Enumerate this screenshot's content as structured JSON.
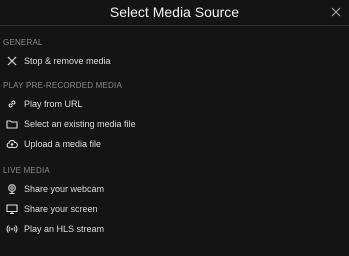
{
  "dialog": {
    "title": "Select Media Source"
  },
  "sections": {
    "general": {
      "heading": "GENERAL",
      "items": [
        {
          "label": "Stop & remove media",
          "icon": "close-icon"
        }
      ]
    },
    "recorded": {
      "heading": "PLAY PRE-RECORDED MEDIA",
      "items": [
        {
          "label": "Play from URL",
          "icon": "link-icon"
        },
        {
          "label": "Select an existing media file",
          "icon": "folder-icon"
        },
        {
          "label": "Upload a media file",
          "icon": "cloud-upload-icon"
        }
      ]
    },
    "live": {
      "heading": "LIVE MEDIA",
      "items": [
        {
          "label": "Share your webcam",
          "icon": "webcam-icon"
        },
        {
          "label": "Share your screen",
          "icon": "monitor-icon"
        },
        {
          "label": "Play an HLS stream",
          "icon": "broadcast-icon"
        }
      ]
    }
  },
  "colors": {
    "background": "#141414",
    "text": "#dcdcdc",
    "section_heading": "#8a8a8a"
  }
}
